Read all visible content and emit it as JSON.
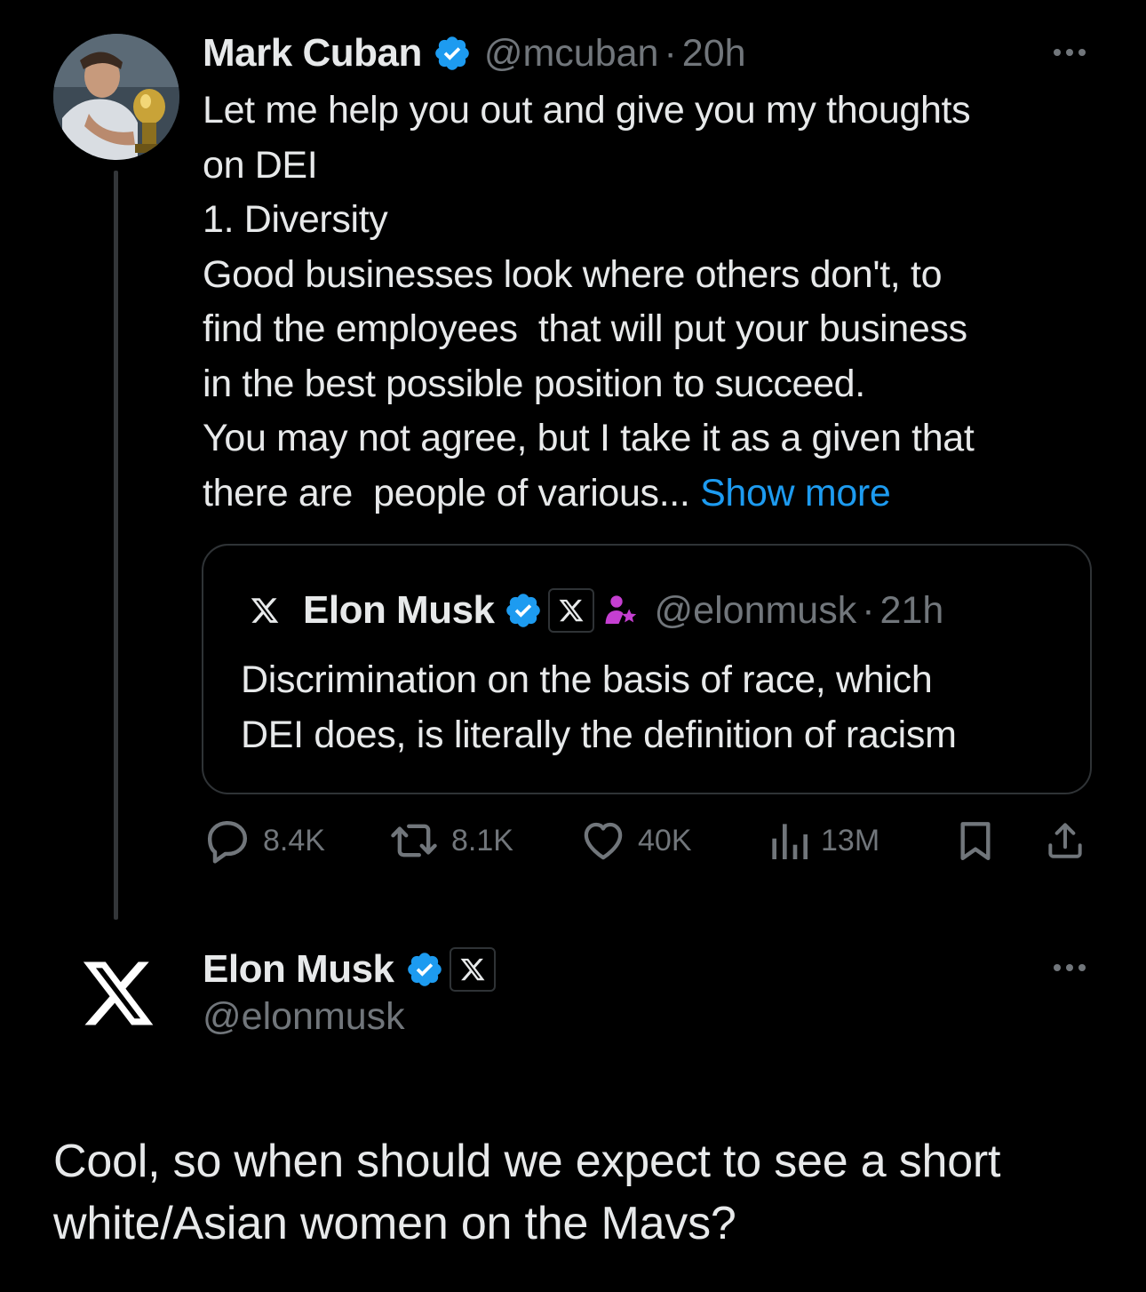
{
  "parent_tweet": {
    "author_name": "Mark Cuban",
    "handle": "@mcuban",
    "separator": "·",
    "time": "20h",
    "body_lines": [
      "Let me help you out and give you my thoughts",
      "on DEI",
      "1. Diversity",
      "Good businesses look where others don't, to",
      "find the employees  that will put your business",
      "in the best possible position to succeed.",
      "You may not agree, but I take it as a given that",
      "there are  people of various... "
    ],
    "show_more": "Show more",
    "quoted_tweet": {
      "author_name": "Elon Musk",
      "handle": "@elonmusk",
      "separator": "·",
      "time": "21h",
      "body_lines": [
        "Discrimination on the basis of race, which",
        "DEI does, is literally the definition of racism"
      ]
    },
    "actions": {
      "replies": "8.4K",
      "reposts": "8.1K",
      "likes": "40K",
      "views": "13M"
    }
  },
  "reply_tweet": {
    "author_name": "Elon Musk",
    "handle": "@elonmusk",
    "body_lines": [
      "Cool, so when should we expect to see a short",
      "white/Asian women on the Mavs?"
    ]
  },
  "icons": {
    "verified": "verified-badge-icon",
    "x_logo": "x-logo-icon",
    "affiliation": "person-star-icon",
    "reply": "speech-bubble-icon",
    "repost": "repost-icon",
    "like": "heart-icon",
    "views": "bar-chart-icon",
    "bookmark": "bookmark-icon",
    "share": "share-upload-icon",
    "more": "more-dots-icon"
  },
  "colors": {
    "background": "#000000",
    "text_primary": "#e7e9ea",
    "text_secondary": "#71767b",
    "accent_link": "#1d9bf0",
    "verified_blue": "#1d9bf0",
    "affiliation_purple": "#c53fd1",
    "border": "#2f3336"
  }
}
